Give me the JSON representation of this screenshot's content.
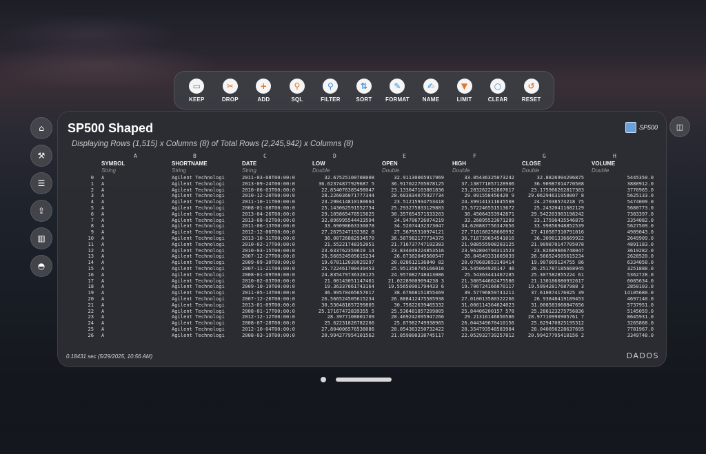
{
  "toolbar": {
    "items": [
      {
        "label": "KEEP",
        "icon": "keep-icon",
        "glyph": "▭",
        "color": "#3a8fd9"
      },
      {
        "label": "DROP",
        "icon": "drop-icon",
        "glyph": "✂",
        "color": "#e07a2e"
      },
      {
        "label": "ADD",
        "icon": "add-icon",
        "glyph": "+",
        "color": "#e07a2e"
      },
      {
        "label": "SQL",
        "icon": "sql-icon",
        "glyph": "⚲",
        "color": "#e07a2e"
      },
      {
        "label": "FILTER",
        "icon": "filter-icon",
        "glyph": "⚲",
        "color": "#3a8fd9"
      },
      {
        "label": "SORT",
        "icon": "sort-icon",
        "glyph": "⇅",
        "color": "#3a8fd9"
      },
      {
        "label": "FORMAT",
        "icon": "format-icon",
        "glyph": "✎",
        "color": "#3a8fd9"
      },
      {
        "label": "NAME",
        "icon": "name-icon",
        "glyph": "✍",
        "color": "#3a8fd9"
      },
      {
        "label": "LIMIT",
        "icon": "limit-icon",
        "glyph": "▼",
        "color": "#e07a2e"
      },
      {
        "label": "CLEAR",
        "icon": "clear-icon",
        "glyph": "○",
        "color": "#3a8fd9"
      },
      {
        "label": "RESET",
        "icon": "reset-icon",
        "glyph": "↺",
        "color": "#e07a2e"
      }
    ]
  },
  "sidenav": {
    "items": [
      {
        "icon": "home-icon",
        "glyph": "⌂"
      },
      {
        "icon": "broom-icon",
        "glyph": "⚒"
      },
      {
        "icon": "checklist-icon",
        "glyph": "☰"
      },
      {
        "icon": "export-icon",
        "glyph": "⇪"
      },
      {
        "icon": "chart-icon",
        "glyph": "▥"
      },
      {
        "icon": "account-icon",
        "glyph": "◓"
      }
    ]
  },
  "panel": {
    "title": "SP500 Shaped",
    "subtitle": "Displaying Rows (1,515) x Columns (8) of Total Rows (2,245,942) x Columns (8)",
    "badge": "SP500",
    "footer": "0.18431 sec  (5/29/2025, 10:56 AM)",
    "logo": "DADOS"
  },
  "table": {
    "letters": [
      "A",
      "B",
      "C",
      "D",
      "E",
      "F",
      "G",
      "H"
    ],
    "headers": [
      "SYMBOL",
      "SHORTNAME",
      "DATE",
      "LOW",
      "OPEN",
      "HIGH",
      "CLOSE",
      "VOLUME"
    ],
    "types": [
      "String",
      "String",
      "String",
      "Double",
      "Double",
      "Double",
      "Double",
      "Double"
    ],
    "rows": [
      [
        "0",
        "A",
        "Agilent Technologi",
        "2011-03-08T00:00:0",
        "32.67525100708008",
        "32.91130065917969",
        "33.05436325073242",
        "32.8826904296875",
        "5445350.0"
      ],
      [
        "1",
        "A",
        "Agilent Technologi",
        "2013-09-24T00:00:0",
        "36.62374877929687 5",
        "36.917022705078125",
        "37.138771057128906",
        "36.90987014770508",
        "3880912.0"
      ],
      [
        "2",
        "A",
        "Agilent Technologi",
        "2010-06-03T00:00:0",
        "22.854076385498047",
        "23.133047103881836",
        "23.283262252807617",
        "23.175966262817383",
        "3770965.0"
      ],
      [
        "3",
        "A",
        "Agilent Technologi",
        "2010-12-20T00:00:0",
        "28.226036071777344",
        "28.683834075927734",
        "29.091558456420 9",
        "29.06294631958007 8",
        "5625133.0"
      ],
      [
        "4",
        "A",
        "Agilent Technologi",
        "2011-10-11T00:00:0",
        "23.290414810180664",
        "23.51215934753418",
        "24.399141311645508",
        "24.27038574218 75",
        "5474009.0"
      ],
      [
        "5",
        "A",
        "Agilent Technologi",
        "2008-01-08T00:00:0",
        "25.143062591552734",
        "25.293275833129883",
        "25.572246551513672",
        "25.24320411682129",
        "5680773.0"
      ],
      [
        "6",
        "A",
        "Agilent Technologi",
        "2013-04-26T00:00:0",
        "29.105865478515625",
        "30.357654571533203",
        "30.45064353942871",
        "29.542203903198242",
        "7383397.0"
      ],
      [
        "7",
        "A",
        "Agilent Technologi",
        "2013-08-02T00:00:0",
        "32.896995544433594",
        "34.94706726074219",
        "33.26895523071289",
        "33.17596435546875",
        "3354082.0"
      ],
      [
        "8",
        "A",
        "Agilent Technologi",
        "2011-06-13T00:00:0",
        "33.69098663330078",
        "34.52074432373047",
        "34.620887756347656",
        "33.99856948852539",
        "5627509.0"
      ],
      [
        "9",
        "A",
        "Agilent Technologi",
        "2012-12-06T00:00:0",
        "27.2675247192382 8",
        "27.56795310974121",
        "27.718168258666992",
        "27.410587310791016",
        "4989043.0"
      ],
      [
        "10",
        "A",
        "Agilent Technologi",
        "2013-10-31T00:00:0",
        "36.00726882934570",
        "36.587982177734375",
        "36.716739654541016",
        "36.30901336669922",
        "2649909.0"
      ],
      [
        "11",
        "A",
        "Agilent Technologi",
        "2010-02-17T00:00:0",
        "21.55221748352051",
        "21.716737747192383",
        "21.988555908203125",
        "21.909870147705078",
        "4891183.0"
      ],
      [
        "12",
        "A",
        "Agilent Technologi",
        "2010-03-15T00:00:0",
        "23.633762359619 14",
        "23.834049224853516",
        "23.962804794311523",
        "23.82689666748047",
        "3619282.0"
      ],
      [
        "13",
        "A",
        "Agilent Technologi",
        "2007-12-27T00:00:0",
        "26.566524505615234",
        "26.67382049560547",
        "26.84549331665039",
        "26.566524505615234",
        "2628520.0"
      ],
      [
        "14",
        "A",
        "Agilent Technologi",
        "2009-09-30T00:00:0",
        "19.678112030029297",
        "20.028612136840 82",
        "20.078683853149414",
        "19.907009124755 86",
        "6334058.0"
      ],
      [
        "15",
        "A",
        "Agilent Technologi",
        "2007-11-21T00:00:0",
        "25.722461700439453",
        "25.951358795166016",
        "26.545064926147 46",
        "26.251787185668945",
        "3251888.0"
      ],
      [
        "16",
        "A",
        "Agilent Technologi",
        "2008-01-09T00:00:0",
        "24.835479736328125",
        "24.957082748413086",
        "25.54363441467285",
        "25.307582855224 61",
        "5362728.0"
      ],
      [
        "17",
        "A",
        "Agilent Technologi",
        "2010-02-03T00:00:0",
        "21.00143051147461",
        "21.02289009094238 3",
        "21.380544662475586",
        "21.130186080932617",
        "6085634.0"
      ],
      [
        "18",
        "A",
        "Agilent Technologi",
        "2009-10-19T00:00:0",
        "19.36337661743164",
        "19.55650901794433 6",
        "19.706724166870117",
        "19.59942817687988 3",
        "2850103.0"
      ],
      [
        "19",
        "A",
        "Agilent Technologi",
        "2011-05-13T00:00:0",
        "36.99570465657617",
        "38.67668151855469",
        "39.57796859741211",
        "37.610874176025 39",
        "14105680.0"
      ],
      [
        "20",
        "A",
        "Agilent Technologi",
        "2007-12-26T00:00:0",
        "26.566524505615234",
        "26.888412475585938",
        "27.010013580322266",
        "26.93848419189453",
        "4697140.0"
      ],
      [
        "21",
        "A",
        "Agilent Technologi",
        "2013-01-09T00:00:0",
        "30.536481857299805",
        "30.75822639465332",
        "31.000114364624023",
        "31.008583068847656",
        "5737951.0"
      ],
      [
        "22",
        "A",
        "Agilent Technologi",
        "2008-01-17T00:00:0",
        "25.17167472839355 5",
        "25.536481857299805",
        "25.84406200157 578",
        "25.286123275756836",
        "5145059.0"
      ],
      [
        "23",
        "A",
        "Agilent Technologi",
        "2012-12-12T00:00:0",
        "28.3977108001709",
        "28.469242095947266",
        "29.21316146850586",
        "28.97710990905761 7",
        "8645931.0"
      ],
      [
        "24",
        "A",
        "Agilent Technologi",
        "2008-07-28T00:00:0",
        "25.62231826782266",
        "25.87982749938965",
        "26.044349670410156",
        "25.629470825195312",
        "3265868.0"
      ],
      [
        "25",
        "A",
        "Agilent Technologi",
        "2012-10-04T00:00:0",
        "27.804006576538086",
        "28.054363250732422",
        "28.354793548583984",
        "28.040056228637695",
        "7781967.0"
      ],
      [
        "26",
        "A",
        "Agilent Technologi",
        "2008-03-19T00:00:0",
        "20.994277954101562",
        "21.859800338745117",
        "22.052932739257812",
        "20.99427795410156 2",
        "3349748.0"
      ]
    ]
  }
}
